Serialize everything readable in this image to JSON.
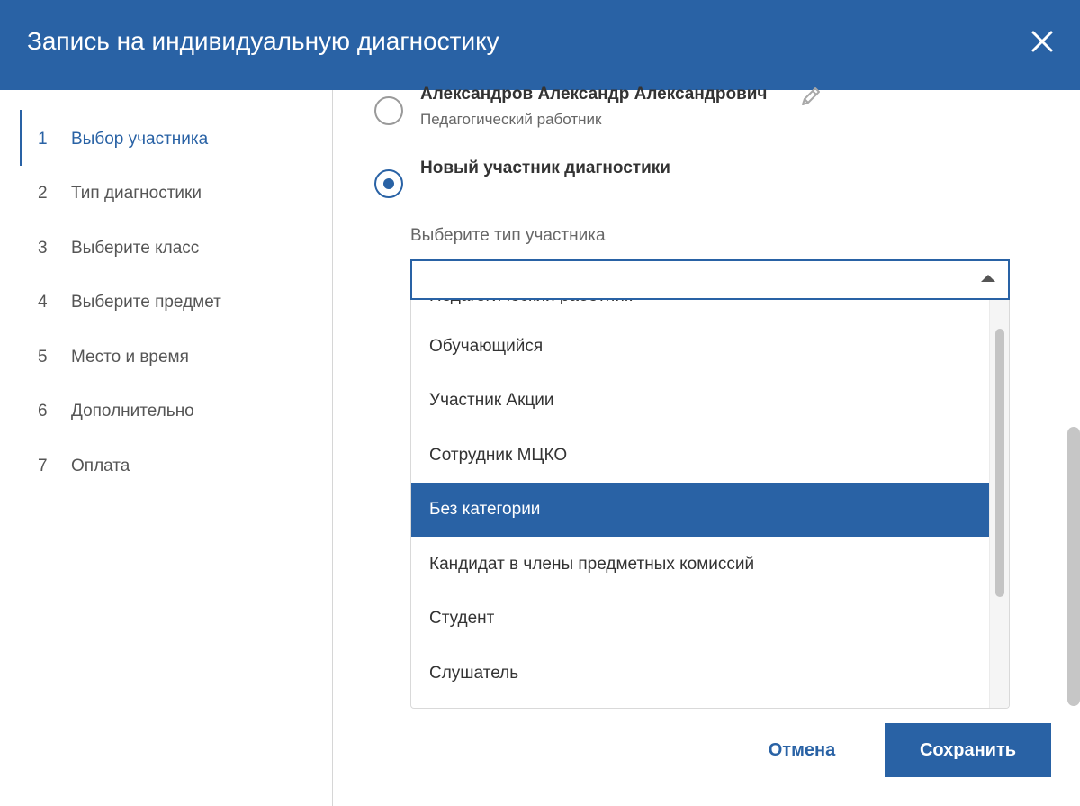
{
  "header": {
    "title": "Запись на индивидуальную диагностику"
  },
  "steps": [
    {
      "num": "1",
      "label": "Выбор участника"
    },
    {
      "num": "2",
      "label": "Тип диагностики"
    },
    {
      "num": "3",
      "label": "Выберите класс"
    },
    {
      "num": "4",
      "label": "Выберите предмет"
    },
    {
      "num": "5",
      "label": "Место и время"
    },
    {
      "num": "6",
      "label": "Дополнительно"
    },
    {
      "num": "7",
      "label": "Оплата"
    }
  ],
  "participant": {
    "name": "Александров Александр Александрович",
    "role": "Педагогический работник",
    "new_label": "Новый участник диагностики"
  },
  "select": {
    "label": "Выберите тип участника",
    "value": "",
    "options_partial": "Педагогический работник",
    "options": [
      "Обучающийся",
      "Участник Акции",
      "Сотрудник МЦКО",
      "Без категории",
      "Кандидат в члены предметных комиссий",
      "Студент",
      "Слушатель"
    ],
    "highlighted": "Без категории"
  },
  "buttons": {
    "cancel": "Отмена",
    "save": "Сохранить"
  },
  "colors": {
    "accent": "#2962a5",
    "header_bg": "#2962a5"
  }
}
